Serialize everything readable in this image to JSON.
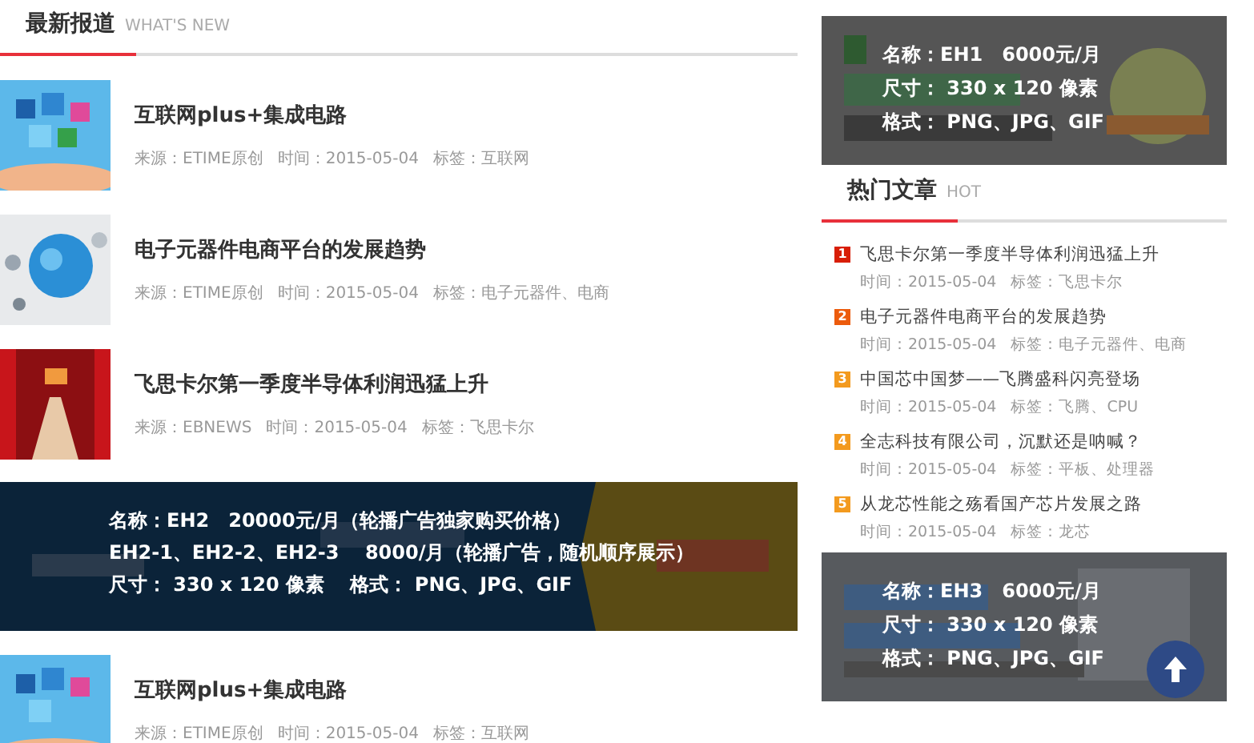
{
  "latest": {
    "title": "最新报道",
    "subtitle": "WHAT'S NEW"
  },
  "articles_top": [
    {
      "title": "互联网plus+集成电路",
      "meta": [
        "来源：ETIME原创",
        "时间：2015-05-04",
        "标签：互联网"
      ]
    },
    {
      "title": "电子元器件电商平台的发展趋势",
      "meta": [
        "来源：ETIME原创",
        "时间：2015-05-04",
        "标签：电子元器件、电商"
      ]
    },
    {
      "title": "飞思卡尔第一季度半导体利润迅猛上升",
      "meta": [
        "来源：EBNEWS",
        "时间：2015-05-04",
        "标签：飞思卡尔"
      ]
    }
  ],
  "banner": {
    "lines": [
      "名称：EH2　20000元/月（轮播广告独家购买价格）",
      "EH2-1、EH2-2、EH2-3　 8000/月（轮播广告，随机顺序展示）",
      "尺寸： 330 x 120 像素　 格式： PNG、JPG、GIF"
    ]
  },
  "articles_bottom": [
    {
      "title": "互联网plus+集成电路",
      "meta": [
        "来源：ETIME原创",
        "时间：2015-05-04",
        "标签：互联网"
      ]
    }
  ],
  "ad_top": {
    "lines": [
      "名称：EH1　6000元/月",
      "尺寸： 330 x 120 像素",
      "格式： PNG、JPG、GIF"
    ]
  },
  "hot": {
    "title": "热门文章",
    "subtitle": "HOT"
  },
  "hot_items": [
    {
      "rank": "1",
      "color": "#d81e06",
      "title": "飞思卡尔第一季度半导体利润迅猛上升",
      "meta": [
        "时间：2015-05-04",
        "标签：飞思卡尔"
      ]
    },
    {
      "rank": "2",
      "color": "#ec5b0c",
      "title": "电子元器件电商平台的发展趋势",
      "meta": [
        "时间：2015-05-04",
        "标签：电子元器件、电商"
      ]
    },
    {
      "rank": "3",
      "color": "#f39a1e",
      "title": "中国芯中国梦——飞腾盛科闪亮登场",
      "meta": [
        "时间：2015-05-04",
        "标签：飞腾、CPU"
      ]
    },
    {
      "rank": "4",
      "color": "#f39a1e",
      "title": "全志科技有限公司，沉默还是呐喊？",
      "meta": [
        "时间：2015-05-04",
        "标签：平板、处理器"
      ]
    },
    {
      "rank": "5",
      "color": "#f39a1e",
      "title": "从龙芯性能之殇看国产芯片发展之路",
      "meta": [
        "时间：2015-05-04",
        "标签：龙芯"
      ]
    }
  ],
  "ad_bottom": {
    "lines": [
      "名称：EH3　6000元/月",
      "尺寸： 330 x 120 像素",
      "格式： PNG、JPG、GIF"
    ]
  }
}
